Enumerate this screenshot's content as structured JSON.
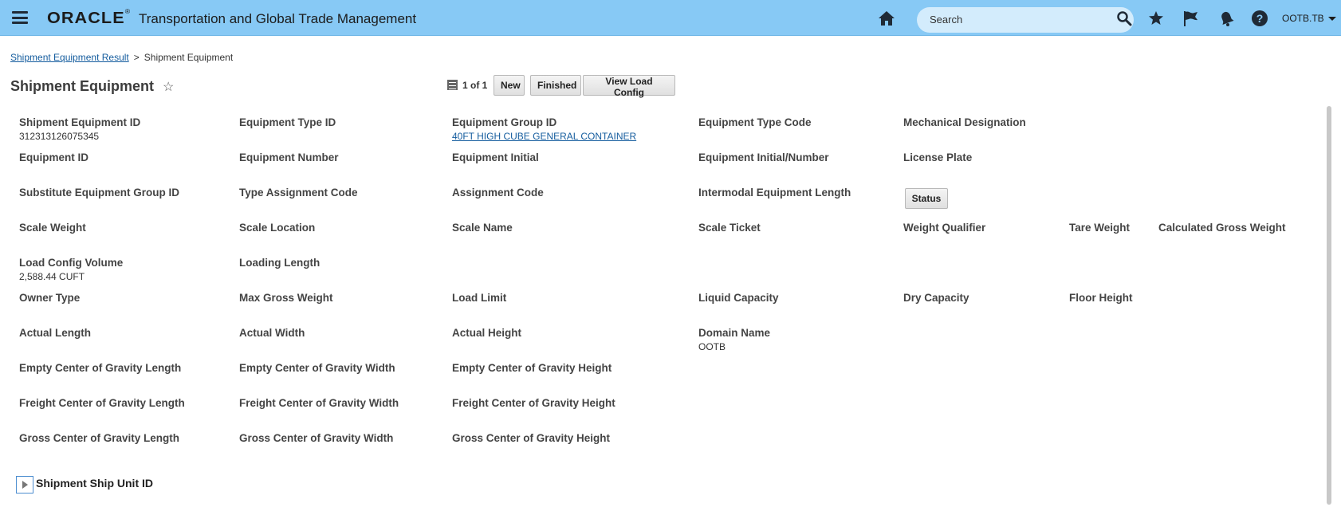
{
  "header": {
    "logo": "ORACLE",
    "logo_mark": "®",
    "app_title": "Transportation and Global Trade Management",
    "search_placeholder": "Search",
    "user": "OOTB.TB",
    "help_glyph": "?"
  },
  "breadcrumb": {
    "parent": "Shipment Equipment Result",
    "separator": ">",
    "current": "Shipment Equipment"
  },
  "page": {
    "title": "Shipment Equipment",
    "favorite_glyph": "☆"
  },
  "toolbar": {
    "pager": "1 of 1",
    "new": "New",
    "finished": "Finished",
    "view_load_config": "View Load Config"
  },
  "fields": {
    "shipment_equipment_id": {
      "label": "Shipment Equipment ID",
      "value": "312313126075345"
    },
    "equipment_type_id": {
      "label": "Equipment Type ID"
    },
    "equipment_group_id": {
      "label": "Equipment Group ID",
      "value": "40FT HIGH CUBE GENERAL CONTAINER"
    },
    "equipment_type_code": {
      "label": "Equipment Type Code"
    },
    "mechanical_designation": {
      "label": "Mechanical Designation"
    },
    "equipment_id": {
      "label": "Equipment ID"
    },
    "equipment_number": {
      "label": "Equipment Number"
    },
    "equipment_initial": {
      "label": "Equipment Initial"
    },
    "equipment_initial_number": {
      "label": "Equipment Initial/Number"
    },
    "license_plate": {
      "label": "License Plate"
    },
    "substitute_equipment_group_id": {
      "label": "Substitute Equipment Group ID"
    },
    "type_assignment_code": {
      "label": "Type Assignment Code"
    },
    "assignment_code": {
      "label": "Assignment Code"
    },
    "intermodal_equipment_length": {
      "label": "Intermodal Equipment Length"
    },
    "scale_weight": {
      "label": "Scale Weight"
    },
    "scale_location": {
      "label": "Scale Location"
    },
    "scale_name": {
      "label": "Scale Name"
    },
    "scale_ticket": {
      "label": "Scale Ticket"
    },
    "weight_qualifier": {
      "label": "Weight Qualifier"
    },
    "tare_weight": {
      "label": "Tare Weight"
    },
    "calculated_gross_weight": {
      "label": "Calculated Gross Weight"
    },
    "load_config_volume": {
      "label": "Load Config Volume",
      "value": "2,588.44 CUFT"
    },
    "loading_length": {
      "label": "Loading Length"
    },
    "owner_type": {
      "label": "Owner Type"
    },
    "max_gross_weight": {
      "label": "Max Gross Weight"
    },
    "load_limit": {
      "label": "Load Limit"
    },
    "liquid_capacity": {
      "label": "Liquid Capacity"
    },
    "dry_capacity": {
      "label": "Dry Capacity"
    },
    "floor_height": {
      "label": "Floor Height"
    },
    "actual_length": {
      "label": "Actual Length"
    },
    "actual_width": {
      "label": "Actual Width"
    },
    "actual_height": {
      "label": "Actual Height"
    },
    "domain_name": {
      "label": "Domain Name",
      "value": "OOTB"
    },
    "empty_cog_length": {
      "label": "Empty Center of Gravity Length"
    },
    "empty_cog_width": {
      "label": "Empty Center of Gravity Width"
    },
    "empty_cog_height": {
      "label": "Empty Center of Gravity Height"
    },
    "freight_cog_length": {
      "label": "Freight Center of Gravity Length"
    },
    "freight_cog_width": {
      "label": "Freight Center of Gravity Width"
    },
    "freight_cog_height": {
      "label": "Freight Center of Gravity Height"
    },
    "gross_cog_length": {
      "label": "Gross Center of Gravity Length"
    },
    "gross_cog_width": {
      "label": "Gross Center of Gravity Width"
    },
    "gross_cog_height": {
      "label": "Gross Center of Gravity Height"
    }
  },
  "status_button": "Status",
  "section": {
    "title": "Shipment Ship Unit ID"
  }
}
